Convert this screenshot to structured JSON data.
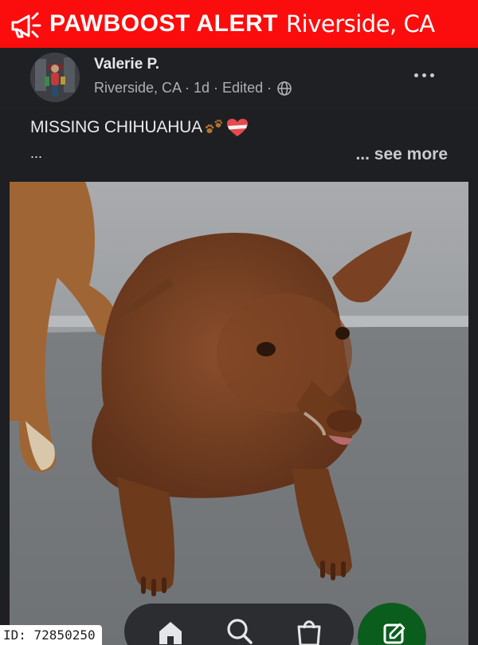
{
  "banner": {
    "brand": "PAWBOOST ALERT",
    "city": "Riverside, CA",
    "icon": "megaphone-icon",
    "background_color": "#fb0d0d"
  },
  "post": {
    "author": "Valerie P.",
    "meta": "Riverside, CA · 1d · Edited ·",
    "text": "MISSING CHIHUAHUA",
    "text_emojis": [
      "paw-prints-icon",
      "heart-icon"
    ],
    "ellipsis": "...",
    "see_more": "... see more",
    "photo": "brown-chihuahua-photo"
  },
  "nav": {
    "items": [
      "home-icon",
      "search-icon",
      "shopping-bag-icon"
    ],
    "fab": "compose-icon",
    "fab_color": "#0b5d1e"
  },
  "id_label": "ID: 72850250"
}
